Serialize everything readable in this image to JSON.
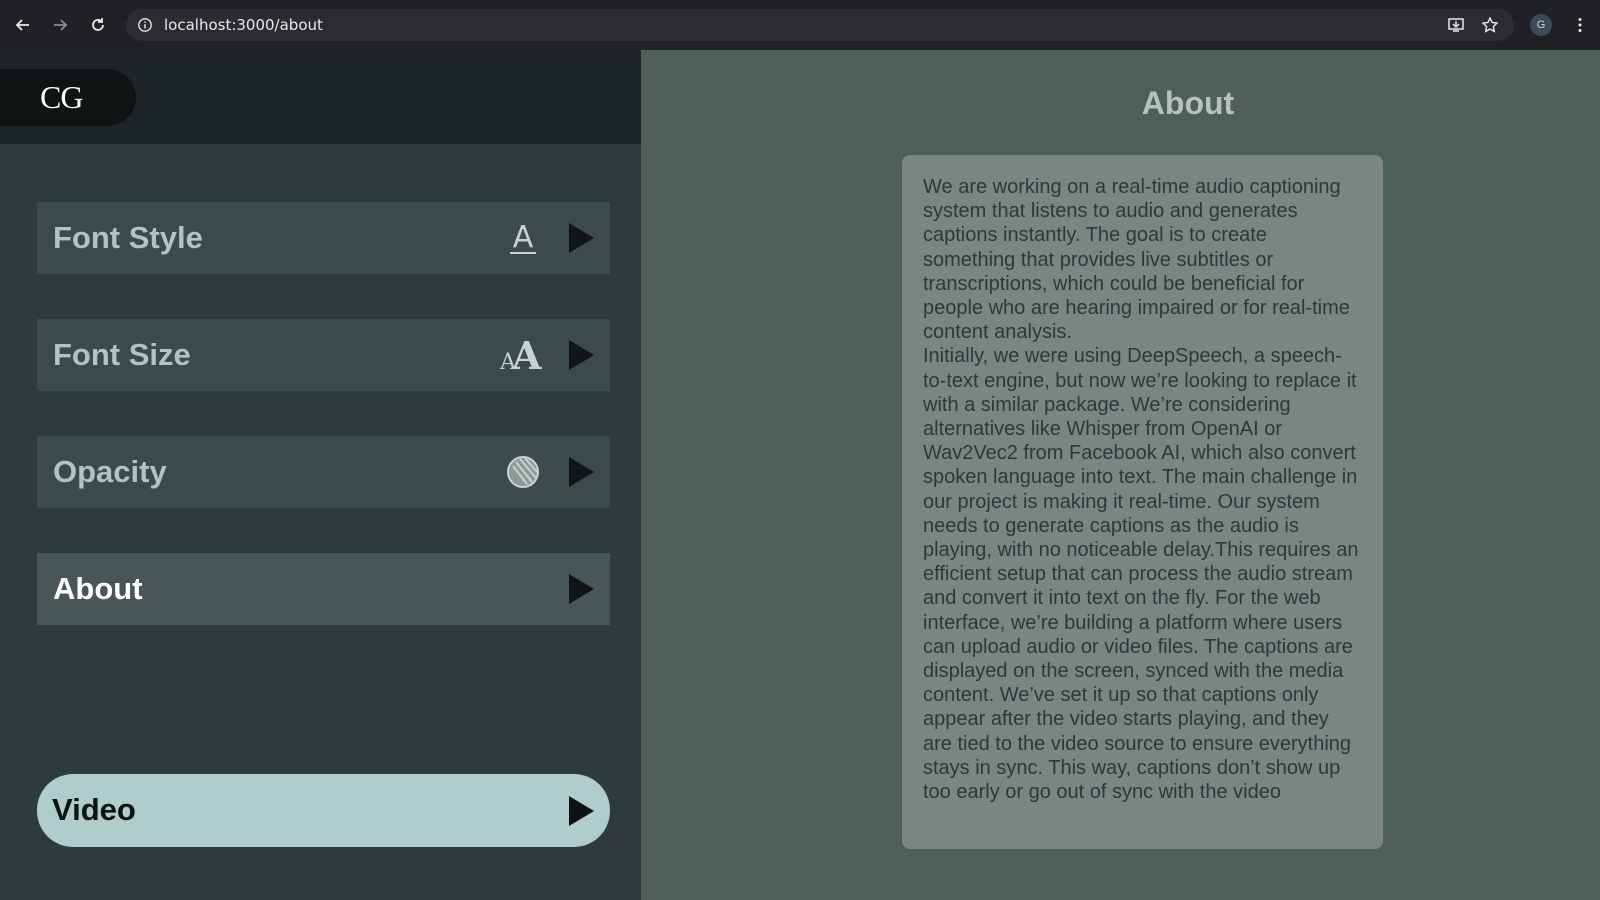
{
  "browser": {
    "url": "localhost:3000/about",
    "profile_initial": "G"
  },
  "logo": {
    "text": "CG"
  },
  "sidebar": {
    "items": [
      {
        "label": "Font Style",
        "icon": "font-style-icon"
      },
      {
        "label": "Font Size",
        "icon": "font-size-icon"
      },
      {
        "label": "Opacity",
        "icon": "opacity-icon"
      },
      {
        "label": "About",
        "icon": ""
      }
    ],
    "video_label": "Video"
  },
  "main": {
    "title": "About",
    "body": "We are working on a real-time audio captioning system that listens to audio and generates captions instantly. The goal is to create something that provides live subtitles or transcriptions, which could be beneficial for people who are hearing impaired or for real-time content analysis.\nInitially, we were using DeepSpeech, a speech-to-text engine, but now we’re looking to replace it with a similar package. We’re considering alternatives like Whisper from OpenAI or Wav2Vec2 from Facebook AI, which also convert spoken language into text. The main challenge in our project is making it real-time. Our system needs to generate captions as the audio is playing, with no noticeable delay.This requires an efficient setup that can process the audio stream and convert it into text on the fly. For the web interface, we’re building a platform where users can upload audio or video files. The captions are displayed on the screen, synced with the media content. We’ve set it up so that captions only appear after the video starts playing, and they are tied to the video source to ensure everything stays in sync. This way, captions don’t show up too early or go out of sync with the video"
  },
  "colors": {
    "sidebar_bg": "#2f3a3b",
    "main_bg": "#4e5e5b",
    "video_button": "#aecdcb",
    "card_bg": "#7b8684"
  }
}
